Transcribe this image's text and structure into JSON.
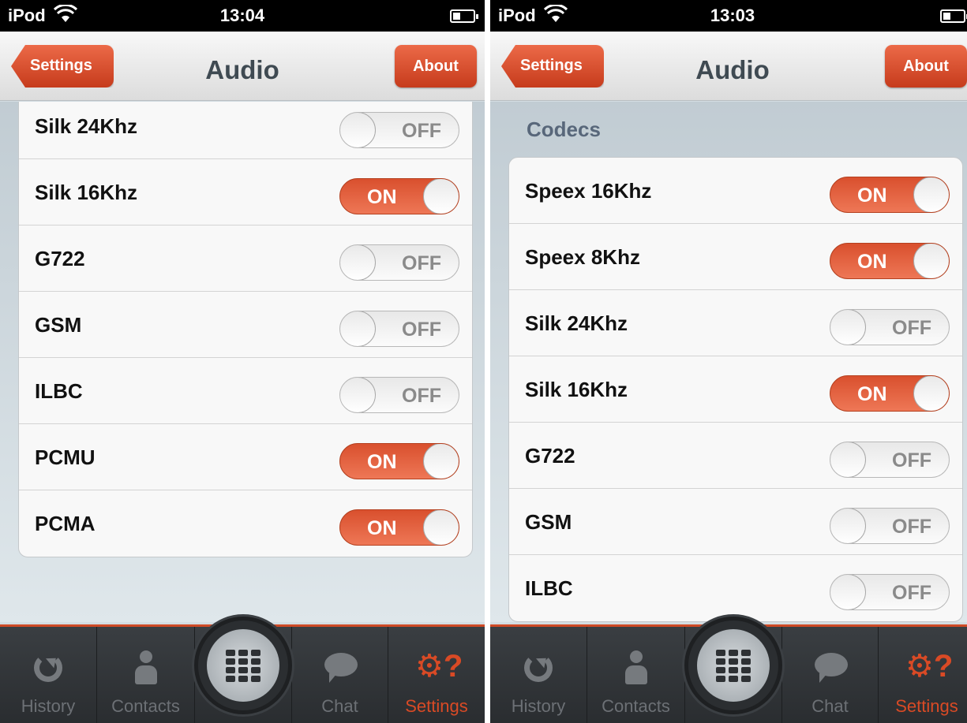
{
  "screens": [
    {
      "status": {
        "carrier": "iPod",
        "time": "13:04"
      },
      "nav": {
        "back_label": "Settings",
        "title": "Audio",
        "about_label": "About"
      },
      "section_header": "",
      "rows": [
        {
          "label": "Silk 24Khz",
          "state": "OFF"
        },
        {
          "label": "Silk 16Khz",
          "state": "ON"
        },
        {
          "label": "G722",
          "state": "OFF"
        },
        {
          "label": "GSM",
          "state": "OFF"
        },
        {
          "label": "ILBC",
          "state": "OFF"
        },
        {
          "label": "PCMU",
          "state": "ON"
        },
        {
          "label": "PCMA",
          "state": "ON"
        }
      ],
      "tabs": [
        {
          "label": "History",
          "icon": "history-icon"
        },
        {
          "label": "Contacts",
          "icon": "contact-icon"
        },
        {
          "label": "Chat",
          "icon": "chat-icon"
        },
        {
          "label": "Settings",
          "icon": "settings-icon",
          "active": true
        }
      ]
    },
    {
      "status": {
        "carrier": "iPod",
        "time": "13:03"
      },
      "nav": {
        "back_label": "Settings",
        "title": "Audio",
        "about_label": "About"
      },
      "section_header": "Codecs",
      "rows": [
        {
          "label": "Speex 16Khz",
          "state": "ON"
        },
        {
          "label": "Speex 8Khz",
          "state": "ON"
        },
        {
          "label": "Silk 24Khz",
          "state": "OFF"
        },
        {
          "label": "Silk 16Khz",
          "state": "ON"
        },
        {
          "label": "G722",
          "state": "OFF"
        },
        {
          "label": "GSM",
          "state": "OFF"
        },
        {
          "label": "ILBC",
          "state": "OFF"
        }
      ],
      "tabs": [
        {
          "label": "History",
          "icon": "history-icon"
        },
        {
          "label": "Contacts",
          "icon": "contact-icon"
        },
        {
          "label": "Chat",
          "icon": "chat-icon"
        },
        {
          "label": "Settings",
          "icon": "settings-icon",
          "active": true
        }
      ]
    }
  ],
  "colors": {
    "accent": "#d94a25",
    "tab_bar": "#2f3235",
    "content_bg": "#d4dde2"
  }
}
